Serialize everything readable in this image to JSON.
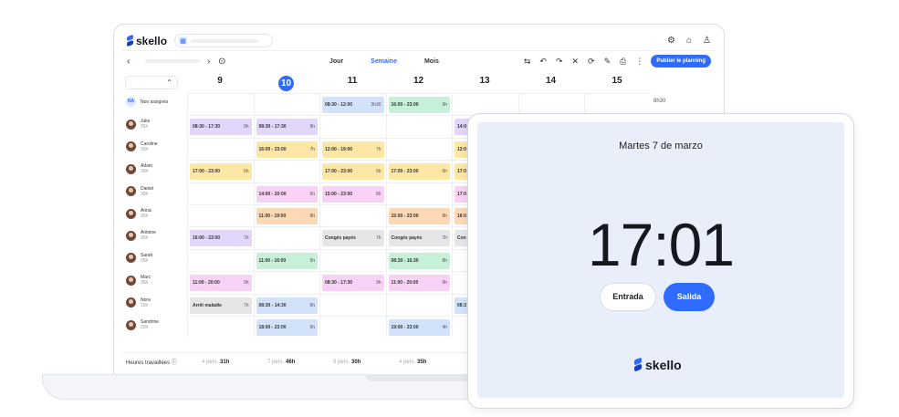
{
  "app": {
    "logo": "skello"
  },
  "toolbar": {
    "prev": "‹",
    "next": "›",
    "views": [
      "Jour",
      "Semaine",
      "Mois"
    ],
    "publish": "Publier le planning"
  },
  "days": [
    "9",
    "10",
    "11",
    "12",
    "13",
    "14",
    "15"
  ],
  "non_assigned": {
    "initials": "NA",
    "label": "Non assignés",
    "total": "8h30",
    "shifts": [
      {
        "day": 2,
        "time": "08:30 - 12:00",
        "dur": "3h30",
        "color": "s-blue"
      },
      {
        "day": 3,
        "time": "16:00 - 23:00",
        "dur": "5h",
        "color": "s-green"
      }
    ]
  },
  "employees": [
    {
      "name": "Julie",
      "hours": "35h",
      "shifts": [
        {
          "day": 0,
          "time": "08:30 - 17:30",
          "dur": "9h",
          "color": "s-purple"
        },
        {
          "day": 1,
          "time": "08:30 - 17:30",
          "dur": "9h",
          "color": "s-purple"
        },
        {
          "day": 4,
          "time": "14:0",
          "dur": "",
          "color": "s-purple"
        }
      ]
    },
    {
      "name": "Caroline",
      "hours": "35h",
      "shifts": [
        {
          "day": 1,
          "time": "16:00 - 23:00",
          "dur": "7h",
          "color": "s-yellow"
        },
        {
          "day": 2,
          "time": "12:00 - 19:00",
          "dur": "7h",
          "color": "s-yellow"
        },
        {
          "day": 4,
          "time": "12:0",
          "dur": "",
          "color": "s-yellow"
        }
      ]
    },
    {
      "name": "Adam",
      "hours": "30h",
      "shifts": [
        {
          "day": 0,
          "time": "17:00 - 23:00",
          "dur": "6h",
          "color": "s-yellow"
        },
        {
          "day": 2,
          "time": "17:00 - 23:00",
          "dur": "6h",
          "color": "s-yellow"
        },
        {
          "day": 3,
          "time": "17:00 - 23:00",
          "dur": "6h",
          "color": "s-yellow"
        },
        {
          "day": 4,
          "time": "17:0",
          "dur": "",
          "color": "s-yellow"
        }
      ]
    },
    {
      "name": "Daniel",
      "hours": "30h",
      "shifts": [
        {
          "day": 1,
          "time": "14:00 - 20:00",
          "dur": "6h",
          "color": "s-pink"
        },
        {
          "day": 2,
          "time": "15:00 - 23:00",
          "dur": "8h",
          "color": "s-pink"
        },
        {
          "day": 4,
          "time": "17:0",
          "dur": "",
          "color": "s-pink"
        }
      ]
    },
    {
      "name": "Anna",
      "hours": "35h",
      "shifts": [
        {
          "day": 1,
          "time": "11:00 - 19:00",
          "dur": "8h",
          "color": "s-orange"
        },
        {
          "day": 3,
          "time": "15:00 - 23:00",
          "dur": "8h",
          "color": "s-orange"
        },
        {
          "day": 4,
          "time": "16:0",
          "dur": "",
          "color": "s-orange"
        }
      ]
    },
    {
      "name": "Antoine",
      "hours": "35h",
      "shifts": [
        {
          "day": 0,
          "time": "16:00 - 23:00",
          "dur": "7h",
          "color": "s-purple"
        },
        {
          "day": 2,
          "time": "Congés payés",
          "dur": "7h",
          "color": "s-gray"
        },
        {
          "day": 3,
          "time": "Congés payés",
          "dur": "7h",
          "color": "s-gray"
        },
        {
          "day": 4,
          "time": "Con",
          "dur": "",
          "color": "s-gray"
        }
      ]
    },
    {
      "name": "Sarah",
      "hours": "35h",
      "shifts": [
        {
          "day": 1,
          "time": "11:00 - 16:00",
          "dur": "5h",
          "color": "s-green"
        },
        {
          "day": 3,
          "time": "08:30 - 16:30",
          "dur": "8h",
          "color": "s-green"
        }
      ]
    },
    {
      "name": "Marc",
      "hours": "35h",
      "shifts": [
        {
          "day": 0,
          "time": "11:00 - 20:00",
          "dur": "9h",
          "color": "s-pink"
        },
        {
          "day": 2,
          "time": "08:30 - 17:30",
          "dur": "9h",
          "color": "s-pink"
        },
        {
          "day": 3,
          "time": "11:00 - 20:00",
          "dur": "9h",
          "color": "s-pink"
        }
      ]
    },
    {
      "name": "Nora",
      "hours": "15h",
      "shifts": [
        {
          "day": 0,
          "time": "Arrêt maladie",
          "dur": "7h",
          "color": "s-gray"
        },
        {
          "day": 1,
          "time": "08:30 - 14:30",
          "dur": "6h",
          "color": "s-blue"
        },
        {
          "day": 4,
          "time": "08:3",
          "dur": "",
          "color": "s-blue"
        }
      ]
    },
    {
      "name": "Sandrine",
      "hours": "20h",
      "shifts": [
        {
          "day": 1,
          "time": "18:00 - 23:00",
          "dur": "5h",
          "color": "s-blue"
        },
        {
          "day": 3,
          "time": "19:00 - 23:00",
          "dur": "4h",
          "color": "s-blue"
        }
      ]
    }
  ],
  "footer": {
    "label": "Heures travaillées",
    "totals": [
      {
        "pers": "4 pers.",
        "hours": "31h"
      },
      {
        "pers": "7 pers.",
        "hours": "46h"
      },
      {
        "pers": "5 pers.",
        "hours": "30h"
      },
      {
        "pers": "4 pers.",
        "hours": "35h"
      }
    ]
  },
  "tablet": {
    "date": "Martes 7 de marzo",
    "time": "17:01",
    "entrada": "Entrada",
    "salida": "Salida",
    "logo": "skello"
  }
}
